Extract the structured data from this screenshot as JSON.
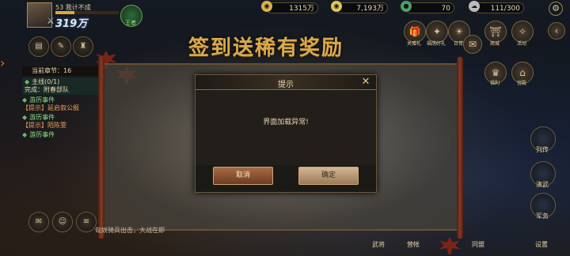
{
  "player": {
    "name": "53 我计不成",
    "power": "319万",
    "vip_label": "王者"
  },
  "resources": [
    {
      "icon": "coin-icon",
      "value": "1315万",
      "color": "#d9b24a"
    },
    {
      "icon": "gold-icon",
      "value": "7,193万",
      "color": "#e0c35a"
    },
    {
      "icon": "jade-icon",
      "value": "70",
      "color": "#4aa070"
    },
    {
      "icon": "stamina-icon",
      "value": "111/300",
      "color": "#bcbcbc"
    }
  ],
  "top_nav": [
    {
      "label": "关赠礼",
      "icon": "gift-icon"
    },
    {
      "label": "福荫好礼",
      "icon": "bonus-icon"
    },
    {
      "label": "日常",
      "icon": "daily-icon"
    },
    {
      "label": "",
      "icon": "bag-icon"
    },
    {
      "label": "商城",
      "icon": "shop-icon"
    },
    {
      "label": "活动",
      "icon": "activity-icon"
    },
    {
      "label": "福利",
      "icon": "welfare-icon"
    },
    {
      "label": "宫殿",
      "icon": "palace-icon"
    }
  ],
  "banner": "签到送稀有奖励",
  "quest": {
    "header": "当前章节：16",
    "items": [
      {
        "title": "主线(0/1)",
        "detail": "完成：附春部队",
        "style": "main"
      },
      {
        "title": "游历事件",
        "detail": "【提示】延启叙公报",
        "style": "event"
      },
      {
        "title": "游历事件",
        "detail": "【提示】陌陈雯",
        "style": "event"
      },
      {
        "title": "游历事件",
        "detail": "",
        "style": "event"
      }
    ]
  },
  "right_side": [
    "列传",
    "演武",
    "军务"
  ],
  "bottom_nav": [
    "武将",
    "营帐",
    "同盟",
    "设置"
  ],
  "bottom_text": "匈奴骑兵出击，大战在即",
  "dialog": {
    "title": "提示",
    "message": "界面加载异常!",
    "cancel": "取消",
    "confirm": "确定"
  }
}
